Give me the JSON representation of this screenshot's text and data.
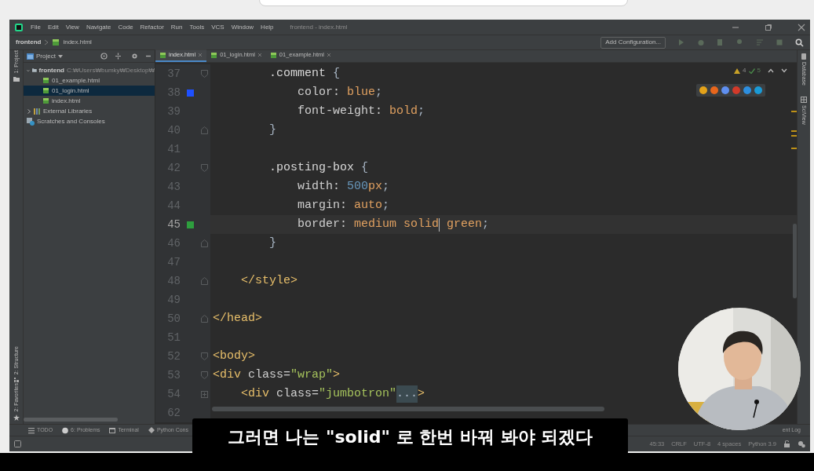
{
  "window": {
    "title": "frontend - index.html"
  },
  "menu": [
    "File",
    "Edit",
    "View",
    "Navigate",
    "Code",
    "Refactor",
    "Run",
    "Tools",
    "VCS",
    "Window",
    "Help"
  ],
  "breadcrumb": [
    "frontend",
    "index.html"
  ],
  "toolbar": {
    "run_config": "Add Configuration..."
  },
  "left_tool_strip": [
    "1: Project",
    "2: Structure",
    "2: Favorites"
  ],
  "project_panel": {
    "title": "Project",
    "tree": [
      {
        "label": "frontend",
        "path": "C:₩Users₩bumky₩Desktop₩",
        "kind": "folder",
        "expanded": true,
        "selected": false,
        "children": [
          {
            "label": "01_example.html",
            "kind": "file",
            "selected": false
          },
          {
            "label": "01_login.html",
            "kind": "file",
            "selected": true
          },
          {
            "label": "index.html",
            "kind": "file",
            "selected": false
          }
        ]
      },
      {
        "label": "External Libraries",
        "kind": "libraries",
        "expanded": false,
        "selected": false
      },
      {
        "label": "Scratches and Consoles",
        "kind": "scratches",
        "selected": false
      }
    ]
  },
  "tabs": [
    {
      "label": "index.html",
      "selected": true
    },
    {
      "label": "01_login.html",
      "selected": false
    },
    {
      "label": "01_example.html",
      "selected": false
    }
  ],
  "inspections": {
    "warnings": "4",
    "checks": "5"
  },
  "browser_icons": [
    {
      "color": "#e3a21a"
    },
    {
      "color": "#e8661c"
    },
    {
      "color": "#5f8ff0"
    },
    {
      "color": "#d23a2a"
    },
    {
      "color": "#2d8fe0"
    },
    {
      "color": "#1a9ad6"
    }
  ],
  "code_lines": [
    {
      "number": "37",
      "fold": {
        "kind": "open"
      },
      "segments": [
        {
          "text": "        .comment",
          "kind": "selector"
        },
        {
          "text": " {",
          "kind": "punct"
        }
      ]
    },
    {
      "number": "38",
      "change_marker": {
        "color": "#1e50ff"
      },
      "segments": [
        {
          "text": "            color: ",
          "kind": "property"
        },
        {
          "text": "blue",
          "kind": "value"
        },
        {
          "text": ";",
          "kind": "punct"
        }
      ]
    },
    {
      "number": "39",
      "segments": [
        {
          "text": "            font-weight: ",
          "kind": "property"
        },
        {
          "text": "bold",
          "kind": "value"
        },
        {
          "text": ";",
          "kind": "punct"
        }
      ]
    },
    {
      "number": "40",
      "fold": {
        "kind": "close"
      },
      "segments": [
        {
          "text": "        }",
          "kind": "punct"
        }
      ]
    },
    {
      "number": "41"
    },
    {
      "number": "42",
      "fold": {
        "kind": "open"
      },
      "segments": [
        {
          "text": "        .posting-box",
          "kind": "selector"
        },
        {
          "text": " {",
          "kind": "punct"
        }
      ]
    },
    {
      "number": "43",
      "segments": [
        {
          "text": "            width: ",
          "kind": "property"
        },
        {
          "text": "500",
          "kind": "number"
        },
        {
          "text": "px",
          "kind": "value"
        },
        {
          "text": ";",
          "kind": "punct"
        }
      ]
    },
    {
      "number": "44",
      "segments": [
        {
          "text": "            margin: ",
          "kind": "property"
        },
        {
          "text": "auto",
          "kind": "value"
        },
        {
          "text": ";",
          "kind": "punct"
        }
      ]
    },
    {
      "number": "45",
      "change_marker": {
        "color": "#2e9e3e"
      },
      "current": true,
      "segments": [
        {
          "text": "            border: ",
          "kind": "property"
        },
        {
          "text": "medium solid",
          "kind": "value"
        },
        {
          "kind": "caret"
        },
        {
          "text": " green",
          "kind": "value"
        },
        {
          "text": ";",
          "kind": "punct"
        }
      ]
    },
    {
      "number": "46",
      "fold": {
        "kind": "close"
      },
      "segments": [
        {
          "text": "        }",
          "kind": "punct"
        }
      ]
    },
    {
      "number": "47"
    },
    {
      "number": "48",
      "fold": {
        "kind": "close"
      },
      "segments": [
        {
          "text": "    </style>",
          "kind": "tag"
        }
      ]
    },
    {
      "number": "49"
    },
    {
      "number": "50",
      "fold": {
        "kind": "close"
      },
      "segments": [
        {
          "text": "</head>",
          "kind": "tag"
        }
      ]
    },
    {
      "number": "51"
    },
    {
      "number": "52",
      "fold": {
        "kind": "open"
      },
      "segments": [
        {
          "text": "<body>",
          "kind": "tag"
        }
      ]
    },
    {
      "number": "53",
      "fold": {
        "kind": "open"
      },
      "segments": [
        {
          "text": "<div",
          "kind": "tag"
        },
        {
          "text": " class=",
          "kind": "attr"
        },
        {
          "text": "\"wrap\"",
          "kind": "string"
        },
        {
          "text": ">",
          "kind": "tag"
        }
      ]
    },
    {
      "number": "54",
      "fold": {
        "kind": "folded"
      },
      "segments": [
        {
          "text": "    <div",
          "kind": "tag"
        },
        {
          "text": " class=",
          "kind": "attr"
        },
        {
          "text": "\"jumbotron\"",
          "kind": "string"
        },
        {
          "text": "...",
          "kind": "folded"
        },
        {
          "text": ">",
          "kind": "tag"
        }
      ]
    },
    {
      "number": "62"
    }
  ],
  "right_tool_strip": [
    "Database",
    "SciView"
  ],
  "tool_tabs": [
    "TODO",
    "6: Problems",
    "Terminal",
    "Python Cons"
  ],
  "event_log": "ent Log",
  "status_bar": [
    "45:33",
    "CRLF",
    "UTF-8",
    "4 spaces",
    "Python 3.9"
  ],
  "webcam": {
    "kind": "picture"
  },
  "subtitle": "그러면 나는 \"solid\" 로 한번 바꿔 봐야 되겠다"
}
